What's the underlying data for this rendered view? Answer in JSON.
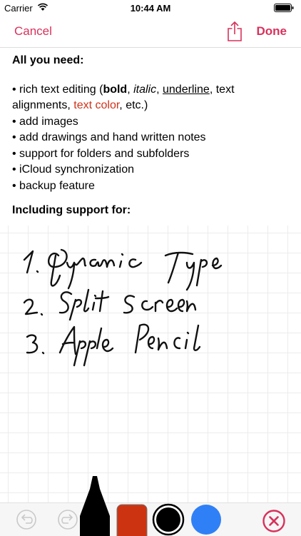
{
  "status": {
    "carrier": "Carrier",
    "time": "10:44 AM"
  },
  "nav": {
    "cancel": "Cancel",
    "done": "Done"
  },
  "content": {
    "heading": "All you need:",
    "item1_prefix": "• rich text editing (",
    "item1_bold": "bold",
    "item1_sep1": ", ",
    "item1_italic": "italic",
    "item1_sep2": ", ",
    "item1_underline": "underline",
    "item1_suffix": ", text",
    "item1_line2_prefix": "alignments, ",
    "item1_red": "text color",
    "item1_line2_suffix": ", etc.)",
    "items": [
      "• add images",
      "• add drawings and hand written notes",
      "• support for folders and subfolders",
      "• iCloud synchronization",
      "• backup feature"
    ],
    "heading2": "Including support for:"
  },
  "handwriting": [
    "1. Dynamic Type",
    "2. Split Screen",
    "3. Apple Pencil"
  ],
  "toolbar": {
    "colors": {
      "black": "#000000",
      "red": "#cc3311",
      "blue": "#2f80f6",
      "accent": "#d8315b"
    }
  }
}
